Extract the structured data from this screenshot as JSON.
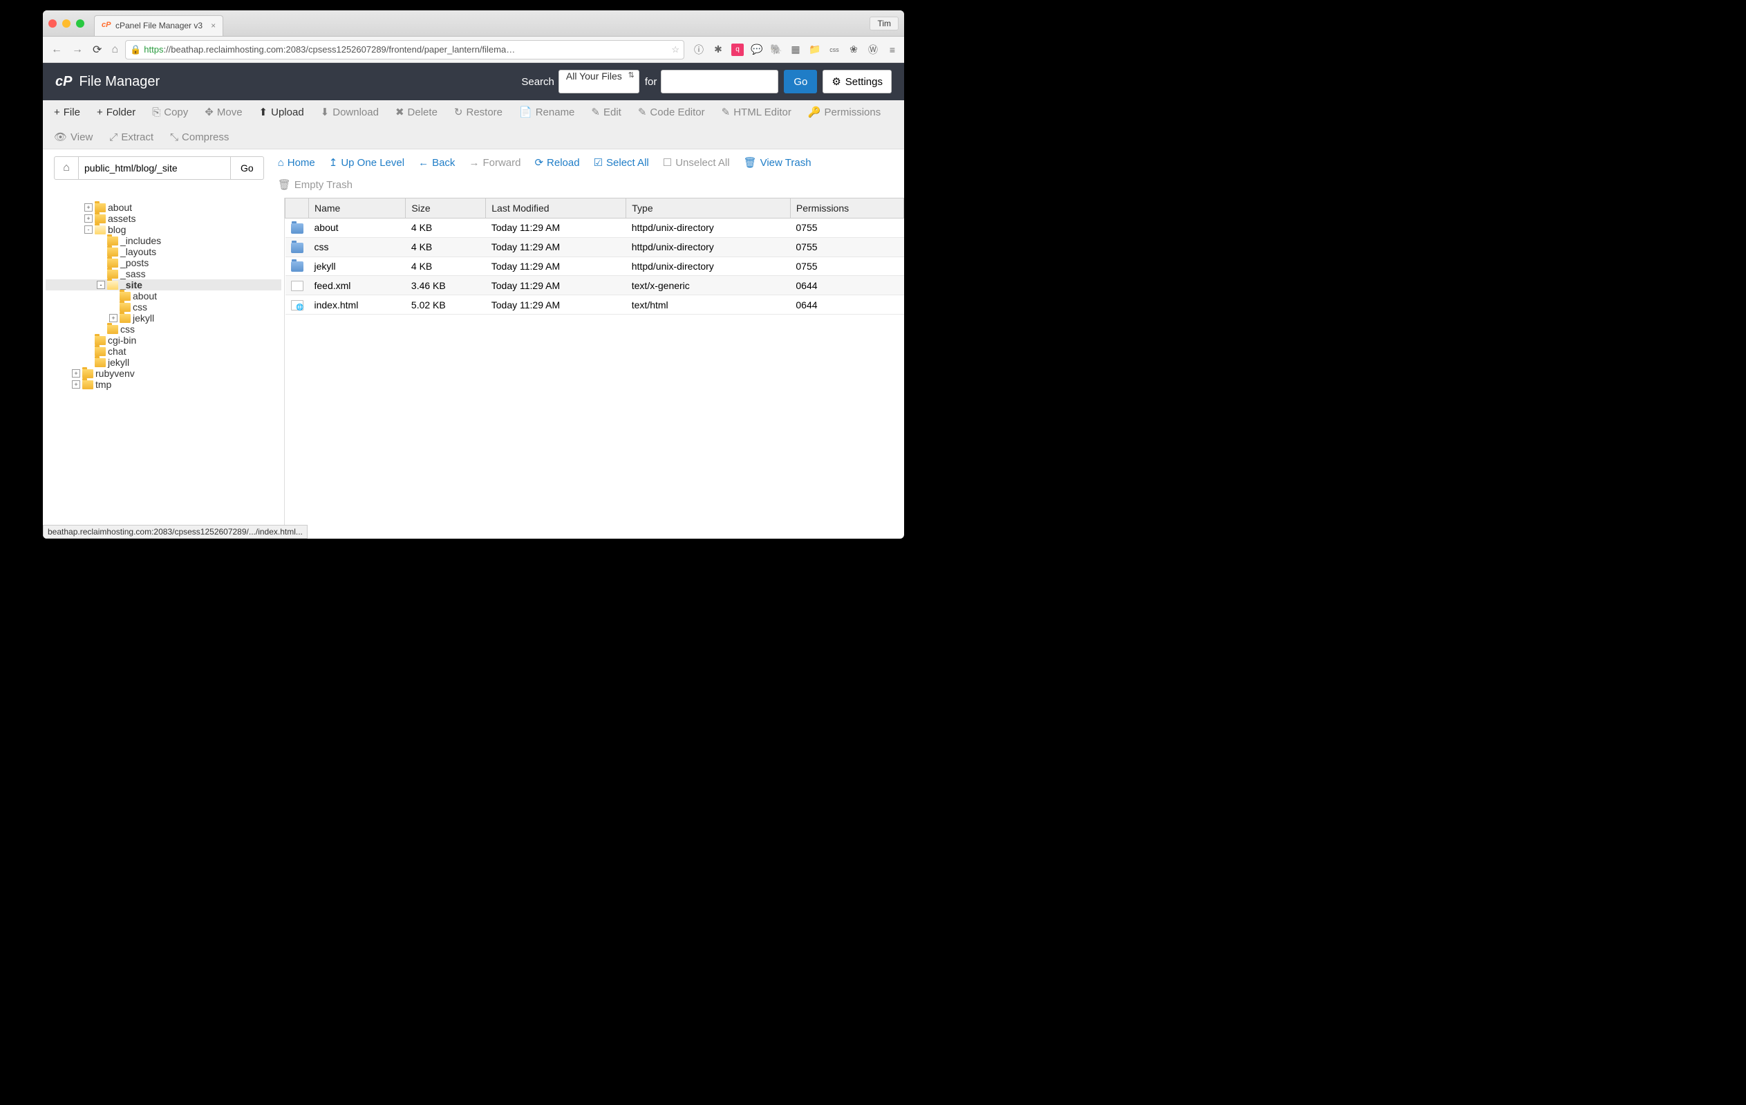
{
  "browser": {
    "tab_title": "cPanel File Manager v3",
    "user_button": "Tim",
    "url_proto": "https",
    "url_rest": "://beathap.reclaimhosting.com:2083/cpsess1252607289/frontend/paper_lantern/filema…"
  },
  "header": {
    "title": "File Manager",
    "search_label": "Search",
    "search_scope": "All Your Files",
    "for_label": "for",
    "search_value": "",
    "go_label": "Go",
    "settings_label": "Settings"
  },
  "toolbar": {
    "items": [
      {
        "icon": "+",
        "label": "File",
        "active": true
      },
      {
        "icon": "+",
        "label": "Folder",
        "active": true
      },
      {
        "icon": "⎘",
        "label": "Copy",
        "active": false
      },
      {
        "icon": "✥",
        "label": "Move",
        "active": false
      },
      {
        "icon": "⬆",
        "label": "Upload",
        "active": true
      },
      {
        "icon": "⬇",
        "label": "Download",
        "active": false
      },
      {
        "icon": "✖",
        "label": "Delete",
        "active": false
      },
      {
        "icon": "↻",
        "label": "Restore",
        "active": false
      },
      {
        "icon": "📄",
        "label": "Rename",
        "active": false
      },
      {
        "icon": "✎",
        "label": "Edit",
        "active": false
      },
      {
        "icon": "✎",
        "label": "Code Editor",
        "active": false
      },
      {
        "icon": "✎",
        "label": "HTML Editor",
        "active": false
      },
      {
        "icon": "🔑",
        "label": "Permissions",
        "active": false
      },
      {
        "icon": "👁",
        "label": "View",
        "active": false
      },
      {
        "icon": "⤢",
        "label": "Extract",
        "active": false
      },
      {
        "icon": "⤡",
        "label": "Compress",
        "active": false
      }
    ]
  },
  "path": {
    "value": "public_html/blog/_site",
    "go_label": "Go"
  },
  "nav": {
    "items": [
      {
        "icon": "⌂",
        "label": "Home",
        "disabled": false
      },
      {
        "icon": "↥",
        "label": "Up One Level",
        "disabled": false
      },
      {
        "icon": "←",
        "label": "Back",
        "disabled": false
      },
      {
        "icon": "→",
        "label": "Forward",
        "disabled": true
      },
      {
        "icon": "⟳",
        "label": "Reload",
        "disabled": false
      },
      {
        "icon": "☑",
        "label": "Select All",
        "disabled": false
      },
      {
        "icon": "☐",
        "label": "Unselect All",
        "disabled": true
      },
      {
        "icon": "🗑",
        "label": "View Trash",
        "disabled": false
      },
      {
        "icon": "🗑",
        "label": "Empty Trash",
        "disabled": true
      }
    ]
  },
  "tree": [
    {
      "label": "about",
      "depth": 2,
      "expand": "+"
    },
    {
      "label": "assets",
      "depth": 2,
      "expand": "+"
    },
    {
      "label": "blog",
      "depth": 2,
      "expand": "-",
      "open": true
    },
    {
      "label": "_includes",
      "depth": 3,
      "expand": ""
    },
    {
      "label": "_layouts",
      "depth": 3,
      "expand": ""
    },
    {
      "label": "_posts",
      "depth": 3,
      "expand": ""
    },
    {
      "label": "_sass",
      "depth": 3,
      "expand": ""
    },
    {
      "label": "_site",
      "depth": 3,
      "expand": "-",
      "open": true,
      "selected": true
    },
    {
      "label": "about",
      "depth": 4,
      "expand": ""
    },
    {
      "label": "css",
      "depth": 4,
      "expand": ""
    },
    {
      "label": "jekyll",
      "depth": 4,
      "expand": "+"
    },
    {
      "label": "css",
      "depth": 3,
      "expand": ""
    },
    {
      "label": "cgi-bin",
      "depth": 2,
      "expand": ""
    },
    {
      "label": "chat",
      "depth": 2,
      "expand": ""
    },
    {
      "label": "jekyll",
      "depth": 2,
      "expand": ""
    },
    {
      "label": "rubyvenv",
      "depth": 1,
      "expand": "+"
    },
    {
      "label": "tmp",
      "depth": 1,
      "expand": "+"
    }
  ],
  "table": {
    "columns": [
      "Name",
      "Size",
      "Last Modified",
      "Type",
      "Permissions"
    ],
    "rows": [
      {
        "icon": "folder",
        "name": "about",
        "size": "4 KB",
        "modified": "Today 11:29 AM",
        "type": "httpd/unix-directory",
        "perms": "0755"
      },
      {
        "icon": "folder",
        "name": "css",
        "size": "4 KB",
        "modified": "Today 11:29 AM",
        "type": "httpd/unix-directory",
        "perms": "0755"
      },
      {
        "icon": "folder",
        "name": "jekyll",
        "size": "4 KB",
        "modified": "Today 11:29 AM",
        "type": "httpd/unix-directory",
        "perms": "0755"
      },
      {
        "icon": "file",
        "name": "feed.xml",
        "size": "3.46 KB",
        "modified": "Today 11:29 AM",
        "type": "text/x-generic",
        "perms": "0644"
      },
      {
        "icon": "html",
        "name": "index.html",
        "size": "5.02 KB",
        "modified": "Today 11:29 AM",
        "type": "text/html",
        "perms": "0644"
      }
    ]
  },
  "status_bar": "beathap.reclaimhosting.com:2083/cpsess1252607289/.../index.html..."
}
